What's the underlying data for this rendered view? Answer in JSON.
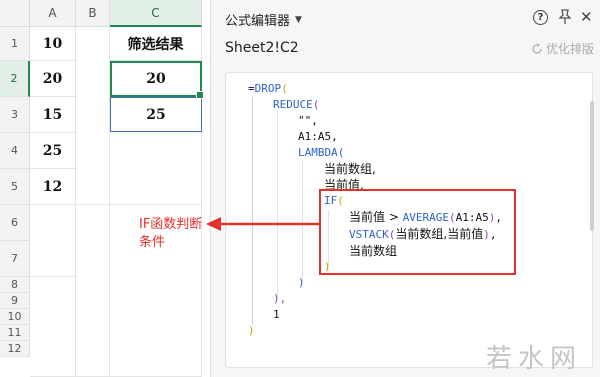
{
  "sheet": {
    "columns": [
      "A",
      "B",
      "C"
    ],
    "rows": [
      "1",
      "2",
      "3",
      "4",
      "5",
      "6",
      "7",
      "8",
      "9",
      "10",
      "11",
      "12"
    ],
    "cells": {
      "c1": "筛选结果",
      "a1": "10",
      "a2": "20",
      "a3": "15",
      "a4": "25",
      "a5": "12",
      "c2": "20",
      "c3": "25"
    },
    "annotation_line1": "IF函数判断",
    "annotation_line2": "条件",
    "colors": {
      "active": "#1f8a4c",
      "range": "#3f6fb8",
      "annotation": "#e2322a"
    }
  },
  "panel": {
    "title": "公式编辑器",
    "cell_ref": "Sheet2!C2",
    "optimize_label": "优化排版",
    "icons": [
      "help-icon",
      "pin-icon",
      "close-icon",
      "chevron-down-icon",
      "optimize-icon"
    ]
  },
  "code": {
    "l1_eq": "=",
    "l1_fn": "DROP",
    "l1_paren": "(",
    "l2_fn": "REDUCE",
    "l2_paren": "(",
    "l3": "\"\",",
    "l4": "A1:A5,",
    "l5_fn": "LAMBDA",
    "l5_paren": "(",
    "l6": "当前数组,",
    "l7": "当前值,",
    "l8_fn": "IF",
    "l8_paren": "(",
    "l9_a": "当前值 > ",
    "l9_fn": "AVERAGE",
    "l9_p": "(",
    "l9_arg": "A1:A5",
    "l9_close": ")",
    "l9_comma": ",",
    "l10_fn": "VSTACK",
    "l10_p": "(",
    "l10_arg": "当前数组,当前值",
    "l10_close": ")",
    "l10_comma": ",",
    "l11": "当前数组",
    "l12": ")",
    "l13": ")",
    "l14": "),",
    "l15": "1",
    "l16": ")"
  },
  "watermark": "若水网"
}
